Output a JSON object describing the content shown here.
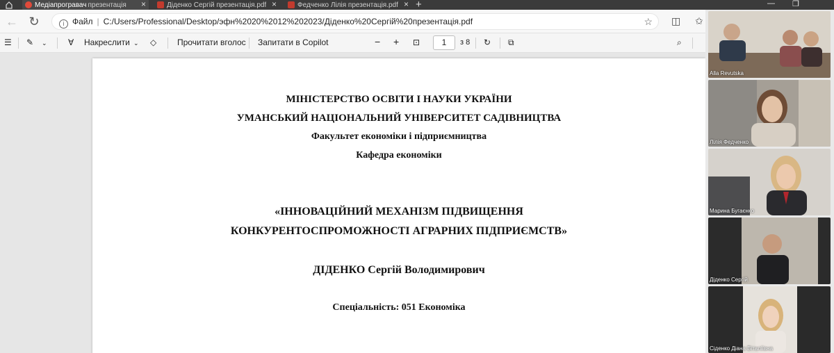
{
  "browser": {
    "tabs": [
      {
        "label": "Медіапрогравач",
        "extra": "презентація",
        "active": true
      },
      {
        "label": "Діденко Сергій презентація.pdf",
        "active": false
      },
      {
        "label": "Федченко Лілія презентація.pdf",
        "active": false
      }
    ],
    "address": {
      "scheme_label": "Файл",
      "url": "C:/Users/Professional/Desktop/эфн%2020%2012%202023/Діденко%20Сергій%20презентація.pdf"
    }
  },
  "pdf_toolbar": {
    "draw_label": "Накреслити",
    "read_aloud_label": "Прочитати вголос",
    "ask_copilot_label": "Запитати в Copilot",
    "page_current": "1",
    "page_total": "з 8"
  },
  "document": {
    "lines": [
      "МІНІСТЕРСТВО ОСВІТИ І НАУКИ  УКРАЇНИ",
      "УМАНСЬКИЙ НАЦІОНАЛЬНИЙ УНІВЕРСИТЕТ САДІВНИЦТВА",
      "Факультет економіки і підприємництва",
      "Кафедра економіки",
      "«ІННОВАЦІЙНИЙ МЕХАНІЗМ ПІДВИЩЕННЯ",
      "КОНКУРЕНТОСПРОМОЖНОСТІ АГРАРНИХ ПІДПРИЄМСТВ»",
      "ДІДЕНКО Сергій Володимирович",
      "Спеціальність: 051 Економіка"
    ]
  },
  "participants": [
    {
      "name": "Alla Revutska"
    },
    {
      "name": "Лілія Федченко"
    },
    {
      "name": "Марина Бугаєнко"
    },
    {
      "name": "Діденко Сергій"
    },
    {
      "name": "Сіденко Діана Віталіївна"
    }
  ],
  "colors": {
    "tabbar_bg": "#3b3b3b",
    "pdf_favicon": "#c23b2e",
    "page_bg": "#ffffff",
    "viewer_bg": "#e6e6e6"
  }
}
